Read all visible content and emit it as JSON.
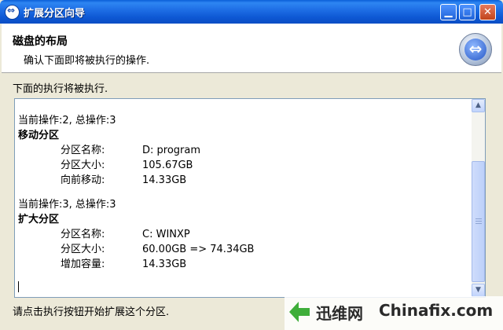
{
  "window": {
    "title": "扩展分区向导"
  },
  "header": {
    "title": "磁盘的布局",
    "subtitle": "确认下面即将被执行的操作."
  },
  "body": {
    "label": "下面的执行将被执行.",
    "operations": [
      {
        "counter": "当前操作:2, 总操作:3",
        "title": "移动分区",
        "rows": [
          {
            "key": "分区名称:",
            "value": "D: program"
          },
          {
            "key": "分区大小:",
            "value": "105.67GB"
          },
          {
            "key": "向前移动:",
            "value": "14.33GB"
          }
        ]
      },
      {
        "counter": "当前操作:3, 总操作:3",
        "title": "扩大分区",
        "rows": [
          {
            "key": "分区名称:",
            "value": "C: WINXP"
          },
          {
            "key": "分区大小:",
            "value": "60.00GB => 74.34GB"
          },
          {
            "key": "增加容量:",
            "value": "14.33GB"
          }
        ]
      }
    ]
  },
  "footer": {
    "text": "请点击执行按钮开始扩展这个分区."
  },
  "watermark": {
    "cn": "迅维网",
    "en": "Chinafix.com"
  }
}
